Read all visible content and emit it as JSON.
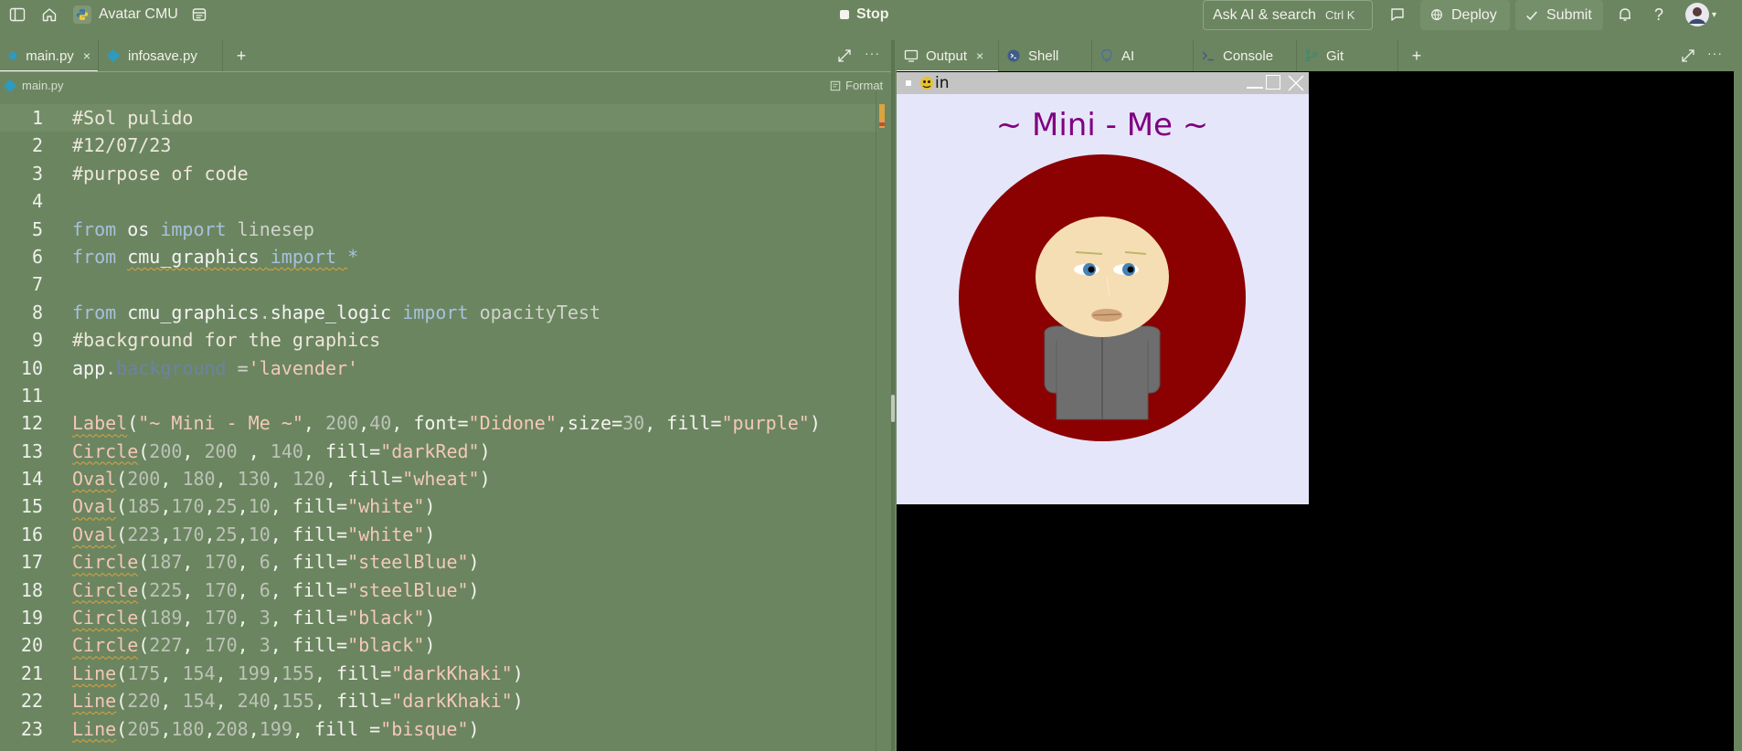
{
  "topbar": {
    "app_name": "Avatar CMU",
    "stop_label": "Stop",
    "search_label": "Ask AI & search",
    "search_shortcut": "Ctrl  K",
    "deploy_label": "Deploy",
    "submit_label": "Submit",
    "help_label": "?"
  },
  "editor": {
    "tabs": [
      {
        "label": "main.py",
        "close": "×"
      },
      {
        "label": "infosave.py",
        "close": ""
      }
    ],
    "add_tab": "+",
    "more": "···",
    "breadcrumb": "main.py",
    "format_label": "Format",
    "lines": [
      [
        {
          "t": "cm",
          "s": "#Sol pulido"
        }
      ],
      [
        {
          "t": "cm",
          "s": "#12/07/23"
        }
      ],
      [
        {
          "t": "cm",
          "s": "#purpose of code"
        }
      ],
      [],
      [
        {
          "t": "kw",
          "s": "from "
        },
        {
          "t": "mod",
          "s": "os "
        },
        {
          "t": "kw",
          "s": "import "
        },
        {
          "t": "dim",
          "s": "linesep"
        }
      ],
      [
        {
          "t": "kw",
          "s": "from "
        },
        {
          "t": "modu",
          "s": "cmu_graphics "
        },
        {
          "t": "kwu",
          "s": "import "
        },
        {
          "t": "star",
          "s": "*"
        }
      ],
      [],
      [
        {
          "t": "kw",
          "s": "from "
        },
        {
          "t": "mod",
          "s": "cmu_graphics"
        },
        {
          "t": "dim",
          "s": "."
        },
        {
          "t": "mod",
          "s": "shape_logic "
        },
        {
          "t": "kw",
          "s": "import "
        },
        {
          "t": "dim",
          "s": "opacityTest"
        }
      ],
      [
        {
          "t": "cm",
          "s": "#background for the graphics"
        }
      ],
      [
        {
          "t": "mod",
          "s": "app"
        },
        {
          "t": "dim",
          "s": "."
        },
        {
          "t": "attr",
          "s": "background "
        },
        {
          "t": "dim",
          "s": "="
        },
        {
          "t": "str",
          "s": "'lavender'"
        }
      ],
      [],
      [
        {
          "t": "fn",
          "s": "Label"
        },
        {
          "t": "p",
          "s": "("
        },
        {
          "t": "str",
          "s": "\"~ Mini - Me ~\""
        },
        {
          "t": "p",
          "s": ", "
        },
        {
          "t": "num",
          "s": "200"
        },
        {
          "t": "p",
          "s": ","
        },
        {
          "t": "num",
          "s": "40"
        },
        {
          "t": "p",
          "s": ", font="
        },
        {
          "t": "str",
          "s": "\"Didone\""
        },
        {
          "t": "p",
          "s": ",size="
        },
        {
          "t": "num",
          "s": "30"
        },
        {
          "t": "p",
          "s": ", fill="
        },
        {
          "t": "str",
          "s": "\"purple\""
        },
        {
          "t": "p",
          "s": ")"
        }
      ],
      [
        {
          "t": "fn",
          "s": "Circle"
        },
        {
          "t": "p",
          "s": "("
        },
        {
          "t": "num",
          "s": "200"
        },
        {
          "t": "p",
          "s": ", "
        },
        {
          "t": "num",
          "s": "200 "
        },
        {
          "t": "p",
          "s": ", "
        },
        {
          "t": "num",
          "s": "140"
        },
        {
          "t": "p",
          "s": ", fill="
        },
        {
          "t": "str",
          "s": "\"darkRed\""
        },
        {
          "t": "p",
          "s": ")"
        }
      ],
      [
        {
          "t": "fn",
          "s": "Oval"
        },
        {
          "t": "p",
          "s": "("
        },
        {
          "t": "num",
          "s": "200"
        },
        {
          "t": "p",
          "s": ", "
        },
        {
          "t": "num",
          "s": "180"
        },
        {
          "t": "p",
          "s": ", "
        },
        {
          "t": "num",
          "s": "130"
        },
        {
          "t": "p",
          "s": ", "
        },
        {
          "t": "num",
          "s": "120"
        },
        {
          "t": "p",
          "s": ", fill="
        },
        {
          "t": "str",
          "s": "\"wheat\""
        },
        {
          "t": "p",
          "s": ")"
        }
      ],
      [
        {
          "t": "fn",
          "s": "Oval"
        },
        {
          "t": "p",
          "s": "("
        },
        {
          "t": "num",
          "s": "185"
        },
        {
          "t": "p",
          "s": ","
        },
        {
          "t": "num",
          "s": "170"
        },
        {
          "t": "p",
          "s": ","
        },
        {
          "t": "num",
          "s": "25"
        },
        {
          "t": "p",
          "s": ","
        },
        {
          "t": "num",
          "s": "10"
        },
        {
          "t": "p",
          "s": ", fill="
        },
        {
          "t": "str",
          "s": "\"white\""
        },
        {
          "t": "p",
          "s": ")"
        }
      ],
      [
        {
          "t": "fn",
          "s": "Oval"
        },
        {
          "t": "p",
          "s": "("
        },
        {
          "t": "num",
          "s": "223"
        },
        {
          "t": "p",
          "s": ","
        },
        {
          "t": "num",
          "s": "170"
        },
        {
          "t": "p",
          "s": ","
        },
        {
          "t": "num",
          "s": "25"
        },
        {
          "t": "p",
          "s": ","
        },
        {
          "t": "num",
          "s": "10"
        },
        {
          "t": "p",
          "s": ", fill="
        },
        {
          "t": "str",
          "s": "\"white\""
        },
        {
          "t": "p",
          "s": ")"
        }
      ],
      [
        {
          "t": "fn",
          "s": "Circle"
        },
        {
          "t": "p",
          "s": "("
        },
        {
          "t": "num",
          "s": "187"
        },
        {
          "t": "p",
          "s": ", "
        },
        {
          "t": "num",
          "s": "170"
        },
        {
          "t": "p",
          "s": ", "
        },
        {
          "t": "num",
          "s": "6"
        },
        {
          "t": "p",
          "s": ", fill="
        },
        {
          "t": "str",
          "s": "\"steelBlue\""
        },
        {
          "t": "p",
          "s": ")"
        }
      ],
      [
        {
          "t": "fn",
          "s": "Circle"
        },
        {
          "t": "p",
          "s": "("
        },
        {
          "t": "num",
          "s": "225"
        },
        {
          "t": "p",
          "s": ", "
        },
        {
          "t": "num",
          "s": "170"
        },
        {
          "t": "p",
          "s": ", "
        },
        {
          "t": "num",
          "s": "6"
        },
        {
          "t": "p",
          "s": ", fill="
        },
        {
          "t": "str",
          "s": "\"steelBlue\""
        },
        {
          "t": "p",
          "s": ")"
        }
      ],
      [
        {
          "t": "fn",
          "s": "Circle"
        },
        {
          "t": "p",
          "s": "("
        },
        {
          "t": "num",
          "s": "189"
        },
        {
          "t": "p",
          "s": ", "
        },
        {
          "t": "num",
          "s": "170"
        },
        {
          "t": "p",
          "s": ", "
        },
        {
          "t": "num",
          "s": "3"
        },
        {
          "t": "p",
          "s": ", fill="
        },
        {
          "t": "str",
          "s": "\"black\""
        },
        {
          "t": "p",
          "s": ")"
        }
      ],
      [
        {
          "t": "fn",
          "s": "Circle"
        },
        {
          "t": "p",
          "s": "("
        },
        {
          "t": "num",
          "s": "227"
        },
        {
          "t": "p",
          "s": ", "
        },
        {
          "t": "num",
          "s": "170"
        },
        {
          "t": "p",
          "s": ", "
        },
        {
          "t": "num",
          "s": "3"
        },
        {
          "t": "p",
          "s": ", fill="
        },
        {
          "t": "str",
          "s": "\"black\""
        },
        {
          "t": "p",
          "s": ")"
        }
      ],
      [
        {
          "t": "fn",
          "s": "Line"
        },
        {
          "t": "p",
          "s": "("
        },
        {
          "t": "num",
          "s": "175"
        },
        {
          "t": "p",
          "s": ", "
        },
        {
          "t": "num",
          "s": "154"
        },
        {
          "t": "p",
          "s": ", "
        },
        {
          "t": "num",
          "s": "199"
        },
        {
          "t": "p",
          "s": ","
        },
        {
          "t": "num",
          "s": "155"
        },
        {
          "t": "p",
          "s": ", fill="
        },
        {
          "t": "str",
          "s": "\"darkKhaki\""
        },
        {
          "t": "p",
          "s": ")"
        }
      ],
      [
        {
          "t": "fn",
          "s": "Line"
        },
        {
          "t": "p",
          "s": "("
        },
        {
          "t": "num",
          "s": "220"
        },
        {
          "t": "p",
          "s": ", "
        },
        {
          "t": "num",
          "s": "154"
        },
        {
          "t": "p",
          "s": ", "
        },
        {
          "t": "num",
          "s": "240"
        },
        {
          "t": "p",
          "s": ","
        },
        {
          "t": "num",
          "s": "155"
        },
        {
          "t": "p",
          "s": ", fill="
        },
        {
          "t": "str",
          "s": "\"darkKhaki\""
        },
        {
          "t": "p",
          "s": ")"
        }
      ],
      [
        {
          "t": "fn",
          "s": "Line"
        },
        {
          "t": "p",
          "s": "("
        },
        {
          "t": "num",
          "s": "205"
        },
        {
          "t": "p",
          "s": ","
        },
        {
          "t": "num",
          "s": "180"
        },
        {
          "t": "p",
          "s": ","
        },
        {
          "t": "num",
          "s": "208"
        },
        {
          "t": "p",
          "s": ","
        },
        {
          "t": "num",
          "s": "199"
        },
        {
          "t": "p",
          "s": ", fill ="
        },
        {
          "t": "str",
          "s": "\"bisque\""
        },
        {
          "t": "p",
          "s": ")"
        }
      ]
    ]
  },
  "panel": {
    "tabs": [
      {
        "label": "Output",
        "icon": "monitor-icon",
        "close": "×"
      },
      {
        "label": "Shell",
        "icon": "shell-icon",
        "close": ""
      },
      {
        "label": "AI",
        "icon": "ai-icon",
        "close": ""
      },
      {
        "label": "Console",
        "icon": "console-icon",
        "close": ""
      },
      {
        "label": "Git",
        "icon": "git-icon",
        "close": ""
      }
    ],
    "add_tab": "+",
    "more": "···"
  },
  "cmu_window": {
    "title": "in",
    "label_text": "~ Mini - Me ~",
    "colors": {
      "background": "#e6e6fa",
      "circle": "#8b0000",
      "face": "#f5deb3",
      "eye_white": "#ffffff",
      "iris": "#4682b4",
      "pupil": "#000000",
      "brow": "#bdb76b",
      "mouth": "#d2a47a",
      "body": "#6e6e6e",
      "label": "#800080"
    }
  }
}
